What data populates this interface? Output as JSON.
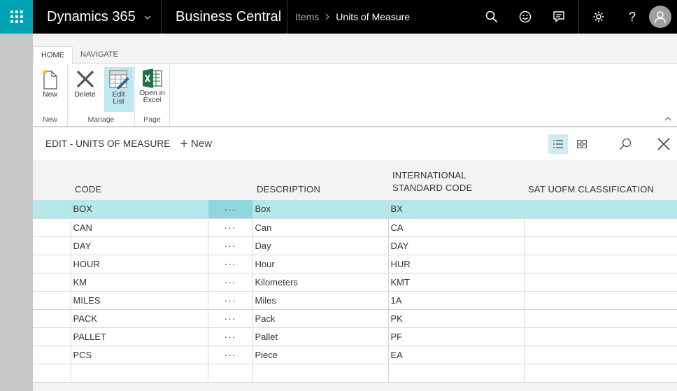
{
  "topbar": {
    "brand": "Dynamics 365",
    "product": "Business Central",
    "breadcrumb": [
      "Items",
      "Units of Measure"
    ]
  },
  "ribbon": {
    "tabs": [
      "HOME",
      "NAVIGATE"
    ],
    "groups": [
      {
        "label": "New",
        "buttons": [
          {
            "label": "New",
            "icon": "new-document-icon"
          }
        ]
      },
      {
        "label": "Manage",
        "buttons": [
          {
            "label": "Delete",
            "icon": "delete-x-icon"
          },
          {
            "label": "Edit List",
            "icon": "edit-list-icon"
          }
        ]
      },
      {
        "label": "Page",
        "buttons": [
          {
            "label": "Open in Excel",
            "icon": "excel-icon"
          }
        ]
      }
    ]
  },
  "page": {
    "title": "EDIT - UNITS OF MEASURE",
    "new_label": "New"
  },
  "table": {
    "columns": [
      "CODE",
      "DESCRIPTION",
      "INTERNATIONAL STANDARD CODE",
      "SAT UOFM CLASSIFICATION"
    ],
    "columns_wrapped": {
      "international_line1": "INTERNATIONAL",
      "international_line2": "STANDARD CODE"
    },
    "rows": [
      {
        "code": "BOX",
        "description": "Box",
        "isc": "BX",
        "sat": ""
      },
      {
        "code": "CAN",
        "description": "Can",
        "isc": "CA",
        "sat": ""
      },
      {
        "code": "DAY",
        "description": "Day",
        "isc": "DAY",
        "sat": ""
      },
      {
        "code": "HOUR",
        "description": "Hour",
        "isc": "HUR",
        "sat": ""
      },
      {
        "code": "KM",
        "description": "Kilometers",
        "isc": "KMT",
        "sat": ""
      },
      {
        "code": "MILES",
        "description": "Miles",
        "isc": "1A",
        "sat": ""
      },
      {
        "code": "PACK",
        "description": "Pack",
        "isc": "PK",
        "sat": ""
      },
      {
        "code": "PALLET",
        "description": "Pallet",
        "isc": "PF",
        "sat": ""
      },
      {
        "code": "PCS",
        "description": "Piece",
        "isc": "EA",
        "sat": ""
      }
    ],
    "dots": "···"
  },
  "colors": {
    "accent": "#00a3b4",
    "selected_row": "#b6e7ea",
    "topbar": "#000000"
  }
}
